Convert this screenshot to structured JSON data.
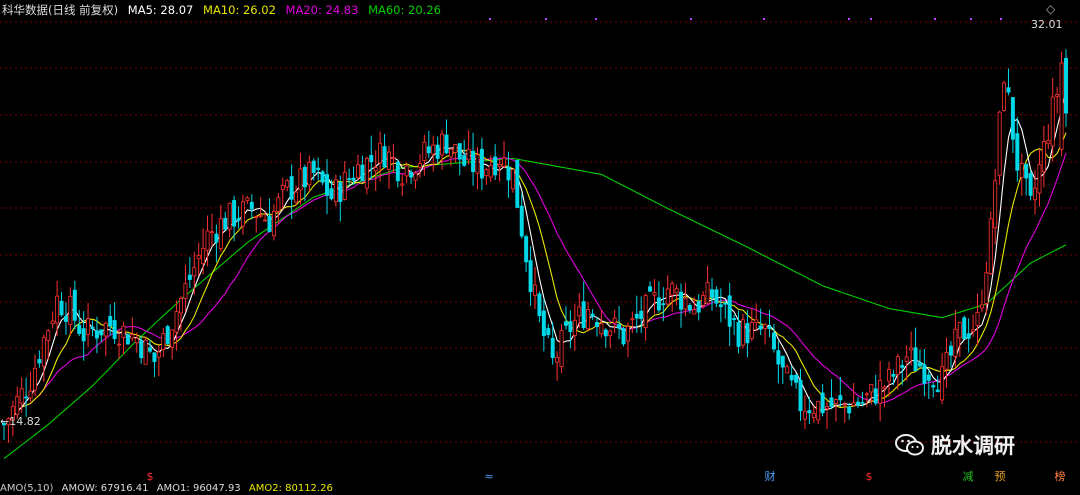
{
  "header": {
    "title": "科华数据(日线 前复权)",
    "ma5": "MA5: 28.07",
    "ma10": "MA10: 26.02",
    "ma20": "MA20: 24.83",
    "ma60": "MA60: 20.26"
  },
  "footer": {
    "amo": "AMO(5,10)",
    "amow": "AMOW: 67916.41",
    "amo1": "AMO1: 96047.93",
    "amo2": "AMO2: 80112.26"
  },
  "watermark": "脱水调研",
  "labels": {
    "low": "14.82",
    "high": "32.01",
    "corner": "◇"
  },
  "colors": {
    "up": "#ff3030",
    "down": "#00d8e8",
    "ma5": "#ffffff",
    "ma10": "#e8e800",
    "ma20": "#e000e0",
    "ma60": "#00d000",
    "grid": "#7a0000"
  },
  "chart_data": {
    "type": "candlestick",
    "ylim": [
      13.5,
      33.2
    ],
    "low_label": 14.82,
    "high_label": 32.01,
    "ma60_anchors": [
      [
        0,
        14
      ],
      [
        10,
        15.5
      ],
      [
        20,
        17.2
      ],
      [
        30,
        19.2
      ],
      [
        40,
        21
      ],
      [
        55,
        23.5
      ],
      [
        70,
        25.5
      ],
      [
        90,
        26.8
      ],
      [
        115,
        27.2
      ],
      [
        135,
        26.5
      ],
      [
        150,
        25
      ],
      [
        168,
        23.3
      ],
      [
        185,
        21.6
      ],
      [
        200,
        20.6
      ],
      [
        212,
        20.2
      ],
      [
        222,
        20.8
      ],
      [
        232,
        22.6
      ],
      [
        240,
        23.4
      ]
    ],
    "price_anchors": [
      [
        0,
        15.5
      ],
      [
        6,
        17.5
      ],
      [
        12,
        21
      ],
      [
        15,
        20.5
      ],
      [
        18,
        19.5
      ],
      [
        24,
        19.9
      ],
      [
        30,
        19.3
      ],
      [
        34,
        18.3
      ],
      [
        40,
        21
      ],
      [
        46,
        23.8
      ],
      [
        50,
        24.5
      ],
      [
        56,
        25
      ],
      [
        60,
        24.5
      ],
      [
        64,
        25.8
      ],
      [
        70,
        26.5
      ],
      [
        74,
        25.5
      ],
      [
        80,
        26.8
      ],
      [
        86,
        27.5
      ],
      [
        90,
        26.7
      ],
      [
        96,
        27.5
      ],
      [
        100,
        28
      ],
      [
        104,
        27
      ],
      [
        108,
        26.8
      ],
      [
        112,
        27.3
      ],
      [
        115,
        26.5
      ],
      [
        118,
        23
      ],
      [
        121,
        20
      ],
      [
        124,
        18.2
      ],
      [
        128,
        19.8
      ],
      [
        132,
        20.6
      ],
      [
        136,
        20
      ],
      [
        140,
        19.4
      ],
      [
        144,
        20.3
      ],
      [
        150,
        21.5
      ],
      [
        156,
        20.7
      ],
      [
        160,
        21.2
      ],
      [
        166,
        19.6
      ],
      [
        172,
        19.6
      ],
      [
        176,
        17.7
      ],
      [
        180,
        16.4
      ],
      [
        188,
        16.3
      ],
      [
        194,
        16.5
      ],
      [
        200,
        17.4
      ],
      [
        204,
        18.5
      ],
      [
        212,
        17.5
      ],
      [
        216,
        19.5
      ],
      [
        220,
        20
      ],
      [
        223,
        24
      ],
      [
        226,
        31
      ],
      [
        229,
        27
      ],
      [
        232,
        25
      ],
      [
        236,
        28.5
      ],
      [
        240,
        31.8
      ]
    ],
    "event_markers": [
      {
        "x": 150,
        "label": "$",
        "color": "#ff3030"
      },
      {
        "x": 489,
        "label": "≈",
        "color": "#4aa0ff"
      },
      {
        "x": 770,
        "label": "财",
        "color": "#4aa0ff"
      },
      {
        "x": 869,
        "label": "$",
        "color": "#ff3030"
      },
      {
        "x": 968,
        "label": "减",
        "color": "#20c020"
      },
      {
        "x": 1000,
        "label": "预",
        "color": "#e8a020"
      },
      {
        "x": 1060,
        "label": "榜",
        "color": "#ff8040"
      }
    ]
  }
}
